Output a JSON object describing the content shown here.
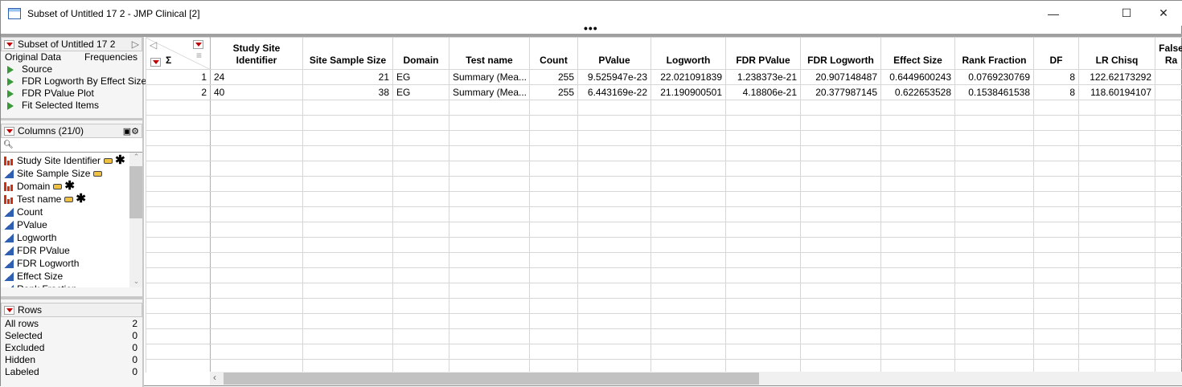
{
  "window": {
    "title": "Subset of Untitled 17 2 - JMP Clinical [2]",
    "more": "•••"
  },
  "table_panel": {
    "title": "Subset of Untitled 17 2",
    "original_data": "Original Data",
    "frequencies": "Frequencies",
    "scripts": [
      "Source",
      "FDR Logworth By Effect Size",
      "FDR PValue Plot",
      "Fit Selected Items"
    ]
  },
  "columns_panel": {
    "title": "Columns (21/0)",
    "search_placeholder": "",
    "items": [
      {
        "name": "Study Site Identifier",
        "type": "nominal",
        "tag": true,
        "star": true
      },
      {
        "name": "Site Sample Size",
        "type": "continuous",
        "tag": true,
        "star": false
      },
      {
        "name": "Domain",
        "type": "nominal",
        "tag": true,
        "star": true
      },
      {
        "name": "Test name",
        "type": "nominal",
        "tag": true,
        "star": true
      },
      {
        "name": "Count",
        "type": "continuous"
      },
      {
        "name": "PValue",
        "type": "continuous"
      },
      {
        "name": "Logworth",
        "type": "continuous"
      },
      {
        "name": "FDR PValue",
        "type": "continuous"
      },
      {
        "name": "FDR Logworth",
        "type": "continuous"
      },
      {
        "name": "Effect Size",
        "type": "continuous"
      },
      {
        "name": "Rank Fraction",
        "type": "continuous"
      }
    ]
  },
  "rows_panel": {
    "title": "Rows",
    "items": [
      {
        "label": "All rows",
        "value": "2"
      },
      {
        "label": "Selected",
        "value": "0"
      },
      {
        "label": "Excluded",
        "value": "0"
      },
      {
        "label": "Hidden",
        "value": "0"
      },
      {
        "label": "Labeled",
        "value": "0"
      }
    ]
  },
  "grid": {
    "sigma": "Σ",
    "headers": [
      "Study Site Identifier",
      "Site Sample Size",
      "Domain",
      "Test name",
      "Count",
      "PValue",
      "Logworth",
      "FDR PValue",
      "FDR Logworth",
      "Effect Size",
      "Rank Fraction",
      "DF",
      "LR Chisq",
      "False Ra"
    ],
    "rows": [
      [
        "1",
        "24",
        "21",
        "EG",
        "Summary (Mea...",
        "255",
        "9.525947e-23",
        "22.021091839",
        "1.238373e-21",
        "20.907148487",
        "0.6449600243",
        "0.0769230769",
        "8",
        "122.62173292",
        ""
      ],
      [
        "2",
        "40",
        "38",
        "EG",
        "Summary (Mea...",
        "255",
        "6.443169e-22",
        "21.190900501",
        "4.18806e-21",
        "20.377987145",
        "0.622653528",
        "0.1538461538",
        "8",
        "118.60194107",
        ""
      ]
    ]
  }
}
